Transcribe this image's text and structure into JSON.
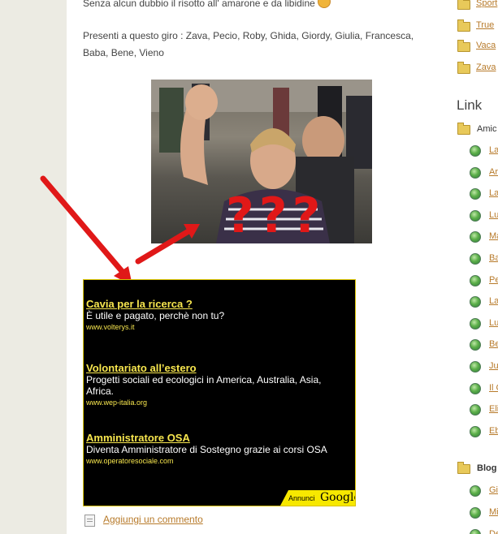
{
  "post": {
    "line_top": "Senza alcun dubbio il risotto all' amarone e da libidine",
    "present": "Presenti a questo giro : Zava, Pecio, Roby, Ghida, Giordy, Giulia, Francesca, Baba, Bene, Vieno",
    "overlay_text": "???"
  },
  "ads": [
    {
      "title": "Cavia per la ricerca ?",
      "desc": "È utile e pagato, perchè non tu?",
      "url": "www.volterys.it"
    },
    {
      "title": "Volontariato all’estero",
      "desc": "Progetti sociali ed ecologici in America, Australia, Asia, Africa.",
      "url": "www.wep-italia.org"
    },
    {
      "title": "Amministratore OSA",
      "desc": "Diventa Amministratore di Sostegno grazie ai corsi OSA",
      "url": "www.operatoresociale.com"
    }
  ],
  "ads_badge": {
    "label": "Annunci",
    "brand": "Google"
  },
  "comment_link": "Aggiungi un commento",
  "sidebar": {
    "top_cats": [
      "Sport",
      "True",
      "Vaca",
      "Zava"
    ],
    "link_heading": "Link",
    "amici_label": "Amic",
    "links": [
      "La",
      "Ar",
      "La",
      "Lu",
      "Ma",
      "Ba",
      "Pe",
      "La",
      "Lu",
      "Be",
      "Ju",
      "Il C",
      "Eli",
      "Eb"
    ],
    "blog_label": "Blog",
    "blog_links": [
      "Gi",
      "Mi",
      "De"
    ]
  },
  "colors": {
    "link": "#b77a2a",
    "ad_title": "#f7e64e",
    "arrow": "#e01818"
  }
}
